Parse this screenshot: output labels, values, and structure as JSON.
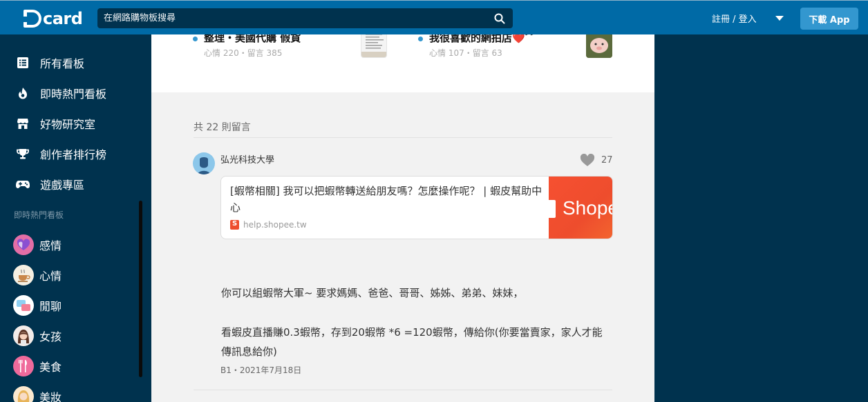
{
  "header": {
    "logo_text": "card",
    "search_placeholder": "在網路購物板搜尋",
    "login_text": "註冊 / 登入",
    "download_label": "下載 App"
  },
  "sidebar": {
    "nav": [
      {
        "label": "所有看板",
        "icon": "list-icon"
      },
      {
        "label": "即時熱門看板",
        "icon": "flame-icon"
      },
      {
        "label": "好物研究室",
        "icon": "store-icon"
      },
      {
        "label": "創作者排行榜",
        "icon": "trophy-icon"
      },
      {
        "label": "遊戲專區",
        "icon": "gamepad-icon"
      }
    ],
    "section_label": "即時熱門看板",
    "boards": [
      {
        "label": "感情",
        "icon": "heart-avatar-icon"
      },
      {
        "label": "心情",
        "icon": "coffee-avatar-icon"
      },
      {
        "label": "閒聊",
        "icon": "chat-avatar-icon"
      },
      {
        "label": "女孩",
        "icon": "girl-avatar-icon"
      },
      {
        "label": "美食",
        "icon": "food-avatar-icon"
      },
      {
        "label": "美妝",
        "icon": "makeup-avatar-icon"
      }
    ]
  },
  "related": [
    {
      "title": "整理・美國代購 假貨",
      "meta": "心情 220・留言 385"
    },
    {
      "title": "我很喜歡的網拍店❤️ﾞﾞ",
      "meta": "心情 107・留言 63"
    }
  ],
  "comments": {
    "count_text": "共 22 則留言",
    "items": [
      {
        "author": "弘光科技大學",
        "likes": "27",
        "link_title": "[蝦幣相關] 我可以把蝦幣轉送給朋友嗎？怎麼操作呢？ | 蝦皮幫助中心",
        "link_domain": "help.shopee.tw",
        "link_image_text": "Shopee",
        "paragraph1": "你可以組蝦幣大軍~ 要求媽媽、爸爸、哥哥、姊姊、弟弟、妹妹，",
        "paragraph2": "看蝦皮直播賺0.3蝦幣，存到20蝦幣 *6 =120蝦幣，傳給你(你要當賣家，家人才能傳訊息給你)",
        "floor": "B1・2021年7月18日"
      }
    ]
  },
  "colors": {
    "header_bg": "#006aa6",
    "sidebar_bg": "#00324e",
    "accent": "#3397cf",
    "shopee": "#ee4d2d"
  }
}
